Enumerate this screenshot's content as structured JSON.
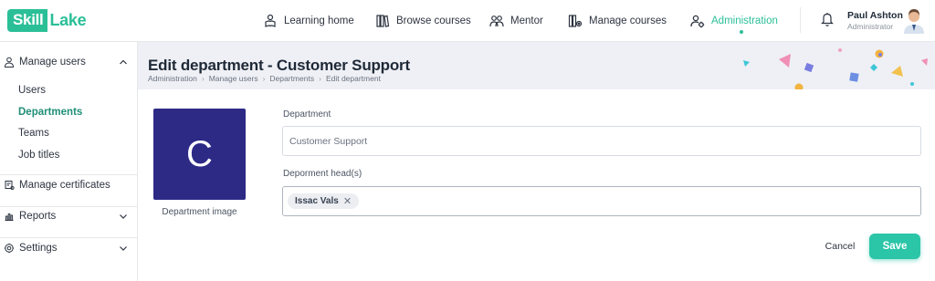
{
  "brand": {
    "part1": "Skill",
    "part2": "Lake"
  },
  "nav": [
    {
      "label": "Learning home",
      "icon": "learning-home-icon"
    },
    {
      "label": "Browse courses",
      "icon": "browse-courses-icon"
    },
    {
      "label": "Mentor",
      "icon": "mentor-icon"
    },
    {
      "label": "Manage courses",
      "icon": "manage-courses-icon"
    },
    {
      "label": "Administration",
      "icon": "administration-icon",
      "active": true
    }
  ],
  "user": {
    "name": "Paul Ashton",
    "role": "Administrator"
  },
  "sidebar": {
    "groups": [
      {
        "label": "Manage users",
        "icon": "user-icon",
        "expanded": true,
        "items": [
          {
            "label": "Users"
          },
          {
            "label": "Departments",
            "active": true
          },
          {
            "label": "Teams"
          },
          {
            "label": "Job titles"
          }
        ]
      },
      {
        "label": "Manage certificates",
        "icon": "certificate-icon"
      },
      {
        "label": "Reports",
        "icon": "reports-icon"
      },
      {
        "label": "Settings",
        "icon": "gear-icon"
      }
    ]
  },
  "header": {
    "title": "Edit department - Customer Support",
    "breadcrumb": [
      "Administration",
      "Manage users",
      "Departments",
      "Edit department"
    ]
  },
  "form": {
    "image_letter": "C",
    "image_caption": "Department image",
    "department_label": "Department",
    "department_value": "Customer Support",
    "head_label": "Deporment head(s)",
    "head_tags": [
      "Issac Vals"
    ]
  },
  "actions": {
    "cancel": "Cancel",
    "save": "Save"
  },
  "colors": {
    "accent": "#2bbf98",
    "image_bg": "#2d2a86",
    "header_bg": "#eef0f5"
  }
}
